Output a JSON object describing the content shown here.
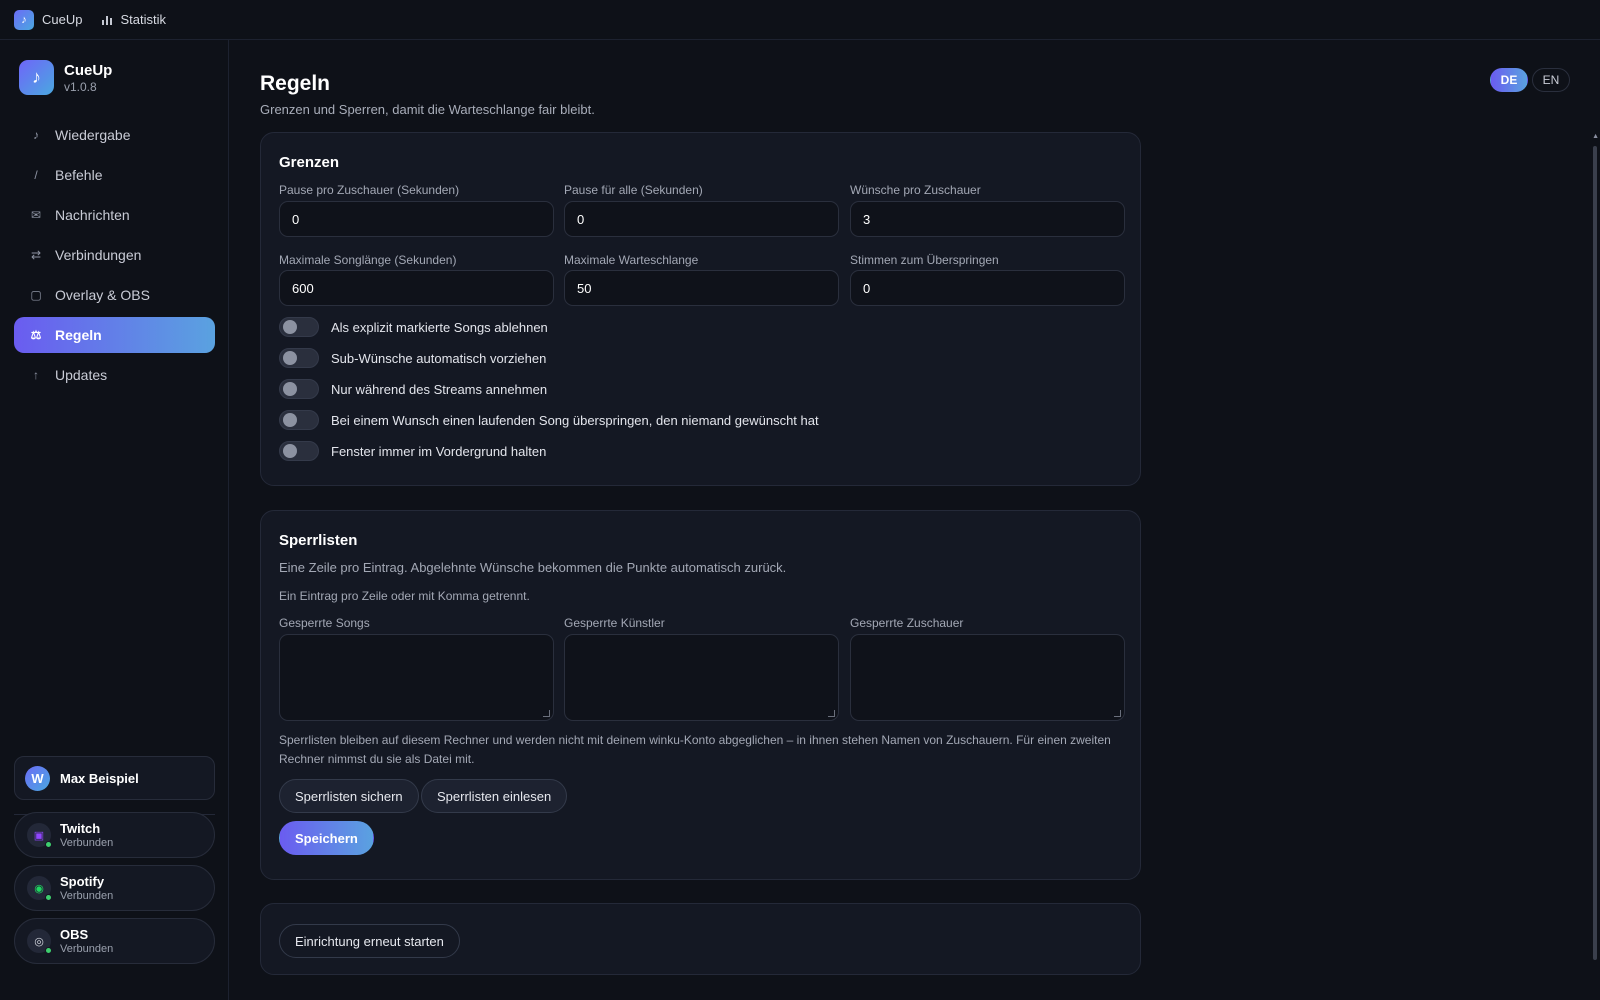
{
  "topbar": {
    "app_label": "CueUp",
    "stats_label": "Statistik"
  },
  "sidebar": {
    "app_name": "CueUp",
    "version": "v1.0.8",
    "items": [
      {
        "label": "Wiedergabe",
        "icon": "music-note-icon",
        "glyph": "♪"
      },
      {
        "label": "Befehle",
        "icon": "slash-icon",
        "glyph": "/"
      },
      {
        "label": "Nachrichten",
        "icon": "mail-icon",
        "glyph": "✉"
      },
      {
        "label": "Verbindungen",
        "icon": "swap-icon",
        "glyph": "⇄"
      },
      {
        "label": "Overlay & OBS",
        "icon": "square-icon",
        "glyph": "▢"
      },
      {
        "label": "Regeln",
        "icon": "rules-icon",
        "glyph": "⚖"
      },
      {
        "label": "Updates",
        "icon": "arrow-up-icon",
        "glyph": "↑"
      }
    ],
    "active_index": 5,
    "user": {
      "name": "Max Beispiel",
      "initial": "W"
    },
    "services": [
      {
        "name": "Twitch",
        "status": "Verbunden",
        "icon": "twitch-icon",
        "color": "#9146ff"
      },
      {
        "name": "Spotify",
        "status": "Verbunden",
        "icon": "spotify-icon",
        "color": "#1ed760"
      },
      {
        "name": "OBS",
        "status": "Verbunden",
        "icon": "obs-icon",
        "color": "#d7dae2"
      }
    ]
  },
  "page": {
    "title": "Regeln",
    "subtitle": "Grenzen und Sperren, damit die Warteschlange fair bleibt.",
    "lang": {
      "de": "DE",
      "en": "EN",
      "active": "DE"
    }
  },
  "limits": {
    "heading": "Grenzen",
    "fields": [
      {
        "label": "Pause pro Zuschauer (Sekunden)",
        "value": "0"
      },
      {
        "label": "Pause für alle (Sekunden)",
        "value": "0"
      },
      {
        "label": "Wünsche pro Zuschauer",
        "value": "3"
      },
      {
        "label": "Maximale Songlänge (Sekunden)",
        "value": "600"
      },
      {
        "label": "Maximale Warteschlange",
        "value": "50"
      },
      {
        "label": "Stimmen zum Überspringen",
        "value": "0"
      }
    ],
    "toggles": [
      {
        "label": "Als explizit markierte Songs ablehnen",
        "on": false
      },
      {
        "label": "Sub-Wünsche automatisch vorziehen",
        "on": false
      },
      {
        "label": "Nur während des Streams annehmen",
        "on": false
      },
      {
        "label": "Bei einem Wunsch einen laufenden Song überspringen, den niemand gewünscht hat",
        "on": false
      },
      {
        "label": "Fenster immer im Vordergrund halten",
        "on": false
      }
    ]
  },
  "blocklists": {
    "heading": "Sperrlisten",
    "description": "Eine Zeile pro Eintrag. Abgelehnte Wünsche bekommen die Punkte automatisch zurück.",
    "hint": "Ein Eintrag pro Zeile oder mit Komma getrennt.",
    "areas": [
      {
        "label": "Gesperrte Songs",
        "value": ""
      },
      {
        "label": "Gesperrte Künstler",
        "value": ""
      },
      {
        "label": "Gesperrte Zuschauer",
        "value": ""
      }
    ],
    "note_line1": "Sperrlisten bleiben auf diesem Rechner und werden nicht mit deinem winku-Konto abgeglichen – in ihnen stehen Namen von Zuschauern. Für einen zweiten",
    "note_line2": "Rechner nimmst du sie als Datei mit.",
    "export_label": "Sperrlisten sichern",
    "import_label": "Sperrlisten einlesen",
    "save_label": "Speichern"
  },
  "setup": {
    "restart_label": "Einrichtung erneut starten"
  }
}
